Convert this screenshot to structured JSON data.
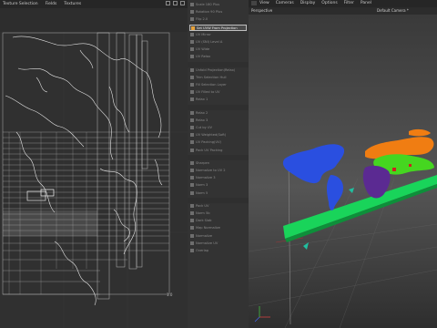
{
  "uv_editor": {
    "menu": [
      "Texture Selection",
      "Fields",
      "Textures"
    ],
    "scale_label": "1.0"
  },
  "uv_commands": {
    "items": [
      "Scale 180 Plus",
      "Rotation 90 Plus",
      "Flip 2.0",
      "Set UVW From Projection",
      "UV Mirror",
      "UV (SNI) Level A",
      "UV Wide",
      "UV Relax",
      "Unfold Projection(Relax)",
      "Trim Selection Hull",
      "Fill Selection Layer",
      "UV Filled to UV",
      "Relax 1",
      "Relax 2",
      "Relax 3",
      "Cut by UV",
      "UV Weighted(Soft)",
      "UV Packing(UV)",
      "Pack UV Packing",
      "Sharpen",
      "Normalize to UV 2",
      "Normalize 3",
      "Norm 3",
      "Norm 5",
      "Pack UV",
      "Norm 5b",
      "Dark Slab",
      "Map Normalize",
      "Normalize",
      "Normalize UV",
      "Overlap"
    ],
    "active_index": 3
  },
  "viewport": {
    "menu": [
      "View",
      "Cameras",
      "Display",
      "Options",
      "Filter",
      "Panel"
    ],
    "projection_label": "Perspective",
    "camera_label": "Default Camera *"
  },
  "colors": {
    "uv_lines": "#d9d9d9",
    "continent_blue": "#2a4fe0",
    "continent_orange": "#f07d12",
    "continent_green": "#45d620",
    "continent_purple": "#5b2a92",
    "ground_strip": "#19d45a",
    "accent_active": "#e8a33c"
  }
}
